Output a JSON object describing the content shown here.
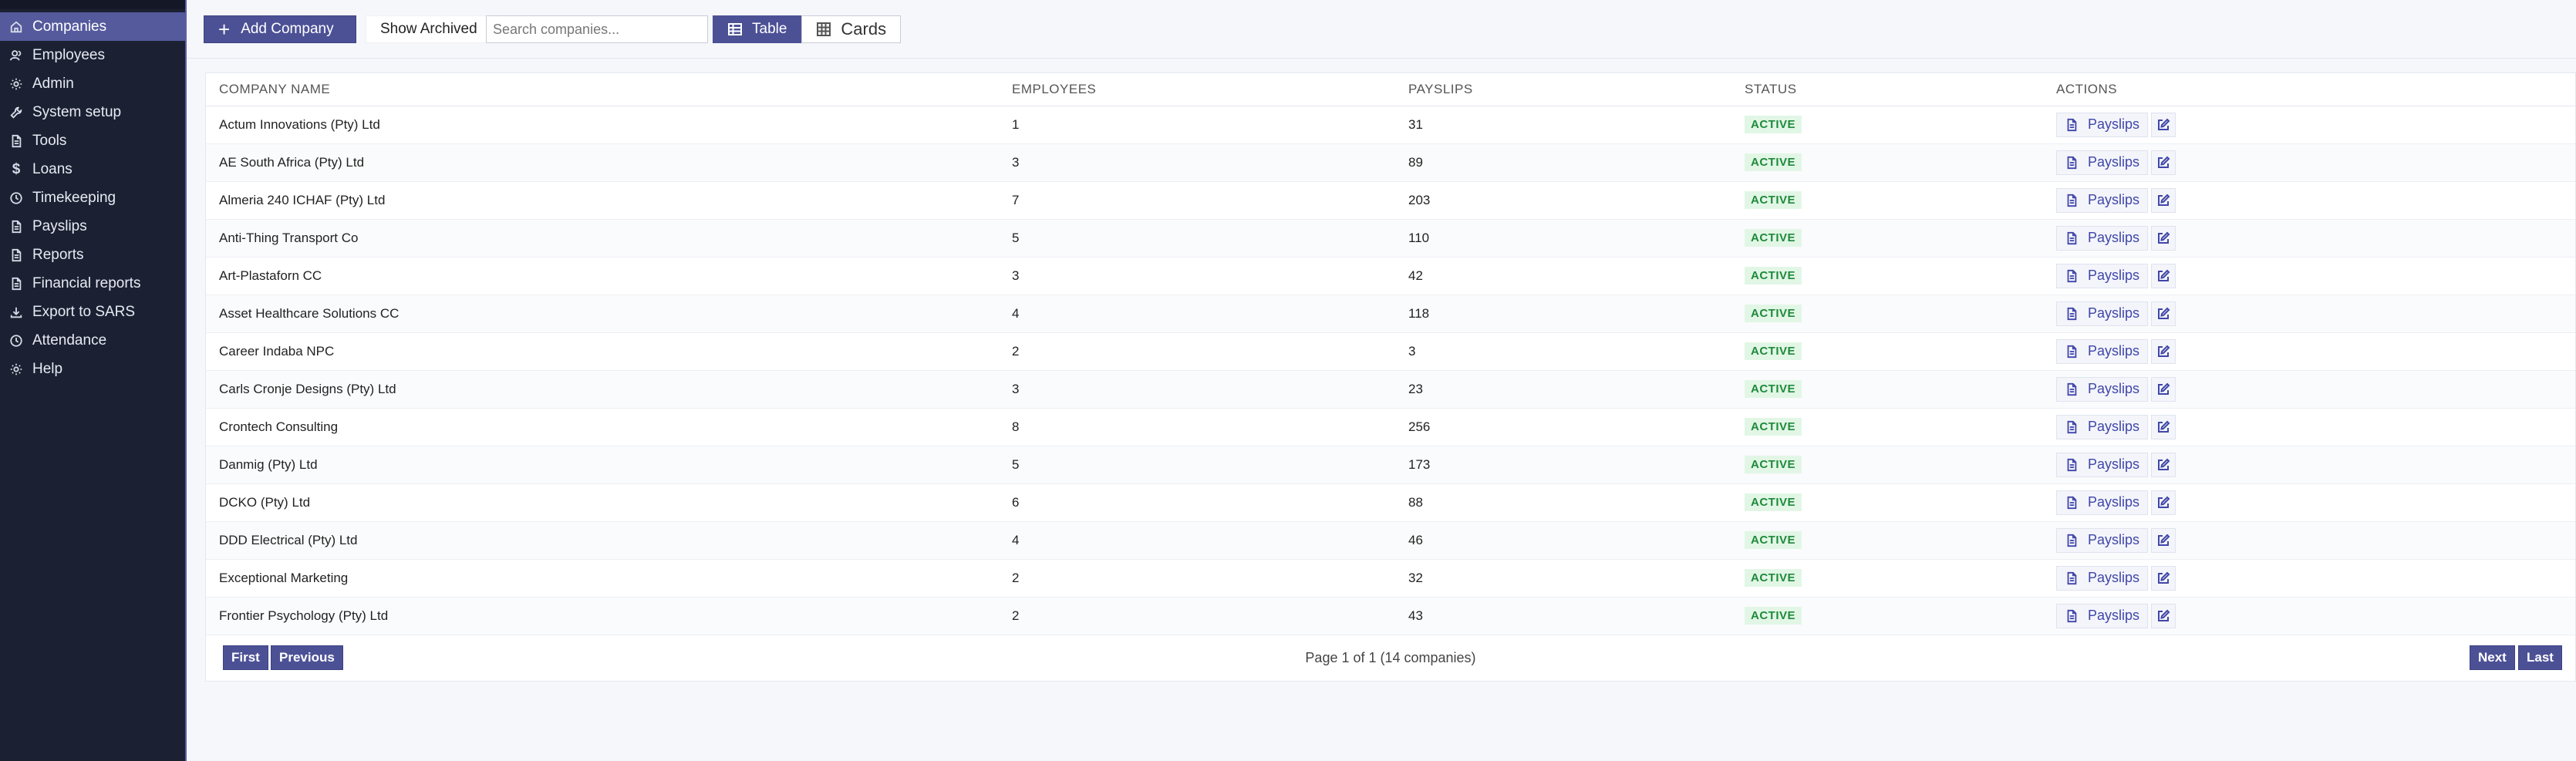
{
  "sidebar": {
    "items": [
      {
        "label": "Companies",
        "icon": "home-icon",
        "active": true
      },
      {
        "label": "Employees",
        "icon": "users-icon"
      },
      {
        "label": "Admin",
        "icon": "gear-icon"
      },
      {
        "label": "System setup",
        "icon": "wrench-icon"
      },
      {
        "label": "Tools",
        "icon": "document-icon"
      },
      {
        "label": "Loans",
        "icon": "dollar-icon"
      },
      {
        "label": "Timekeeping",
        "icon": "clock-icon"
      },
      {
        "label": "Payslips",
        "icon": "document-icon"
      },
      {
        "label": "Reports",
        "icon": "document-icon"
      },
      {
        "label": "Financial reports",
        "icon": "document-icon"
      },
      {
        "label": "Export to SARS",
        "icon": "download-icon"
      },
      {
        "label": "Attendance",
        "icon": "clock-icon"
      },
      {
        "label": "Help",
        "icon": "gear-icon"
      }
    ]
  },
  "toolbar": {
    "add_label": "Add Company",
    "archived_label": "Show Archived",
    "search_placeholder": "Search companies...",
    "table_label": "Table",
    "cards_label": "Cards"
  },
  "table": {
    "headers": {
      "name": "COMPANY NAME",
      "employees": "EMPLOYEES",
      "payslips": "PAYSLIPS",
      "status": "STATUS",
      "actions": "ACTIONS"
    },
    "action_label": "Payslips",
    "rows": [
      {
        "name": "Actum Innovations (Pty) Ltd",
        "employees": "1",
        "payslips": "31",
        "status": "ACTIVE"
      },
      {
        "name": "AE South Africa (Pty) Ltd",
        "employees": "3",
        "payslips": "89",
        "status": "ACTIVE"
      },
      {
        "name": "Almeria 240 ICHAF (Pty) Ltd",
        "employees": "7",
        "payslips": "203",
        "status": "ACTIVE"
      },
      {
        "name": "Anti-Thing Transport Co",
        "employees": "5",
        "payslips": "110",
        "status": "ACTIVE"
      },
      {
        "name": "Art-Plastaforn CC",
        "employees": "3",
        "payslips": "42",
        "status": "ACTIVE"
      },
      {
        "name": "Asset Healthcare Solutions CC",
        "employees": "4",
        "payslips": "118",
        "status": "ACTIVE"
      },
      {
        "name": "Career Indaba NPC",
        "employees": "2",
        "payslips": "3",
        "status": "ACTIVE"
      },
      {
        "name": "Carls Cronje Designs (Pty) Ltd",
        "employees": "3",
        "payslips": "23",
        "status": "ACTIVE"
      },
      {
        "name": "Crontech Consulting",
        "employees": "8",
        "payslips": "256",
        "status": "ACTIVE"
      },
      {
        "name": "Danmig (Pty) Ltd",
        "employees": "5",
        "payslips": "173",
        "status": "ACTIVE"
      },
      {
        "name": "DCKO (Pty) Ltd",
        "employees": "6",
        "payslips": "88",
        "status": "ACTIVE"
      },
      {
        "name": "DDD Electrical (Pty) Ltd",
        "employees": "4",
        "payslips": "46",
        "status": "ACTIVE"
      },
      {
        "name": "Exceptional Marketing",
        "employees": "2",
        "payslips": "32",
        "status": "ACTIVE"
      },
      {
        "name": "Frontier Psychology (Pty) Ltd",
        "employees": "2",
        "payslips": "43",
        "status": "ACTIVE"
      }
    ]
  },
  "pagination": {
    "first": "First",
    "previous": "Previous",
    "info": "Page 1 of 1 (14 companies)",
    "next": "Next",
    "last": "Last"
  }
}
